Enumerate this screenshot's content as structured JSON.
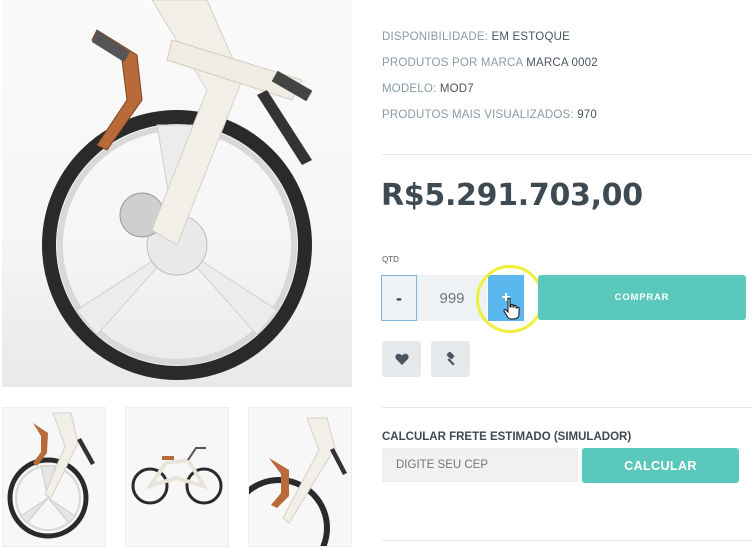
{
  "gallery": {
    "main_image": "bike-front-wheel-closeup",
    "thumbnails": [
      "bike-front-wheel-closeup",
      "bike-full-side-view",
      "bike-front-wheel-closeup"
    ]
  },
  "meta": {
    "availability_label": "Disponibilidade:",
    "availability_value": "Em Estoque",
    "brand_label": "Produtos por marca",
    "brand_value": "Marca 0002",
    "model_label": "Modelo:",
    "model_value": "MOD7",
    "views_label": "Produtos mais visualizados:",
    "views_value": "970"
  },
  "price": "R$5.291.703,00",
  "quantity": {
    "label": "QTD",
    "minus": "-",
    "value": "999",
    "plus": "+"
  },
  "buy_button": "Comprar",
  "icons": {
    "wishlist": "heart-icon",
    "compare": "gavel-icon"
  },
  "shipping": {
    "title": "Calcular frete estimado (Simulador)",
    "placeholder": "DIGITE SEU CEP",
    "button": "CALCULAR"
  },
  "colors": {
    "accent": "#5bc8bc",
    "plus_active": "#5ab8ef",
    "highlight": "#f0ef3c"
  }
}
